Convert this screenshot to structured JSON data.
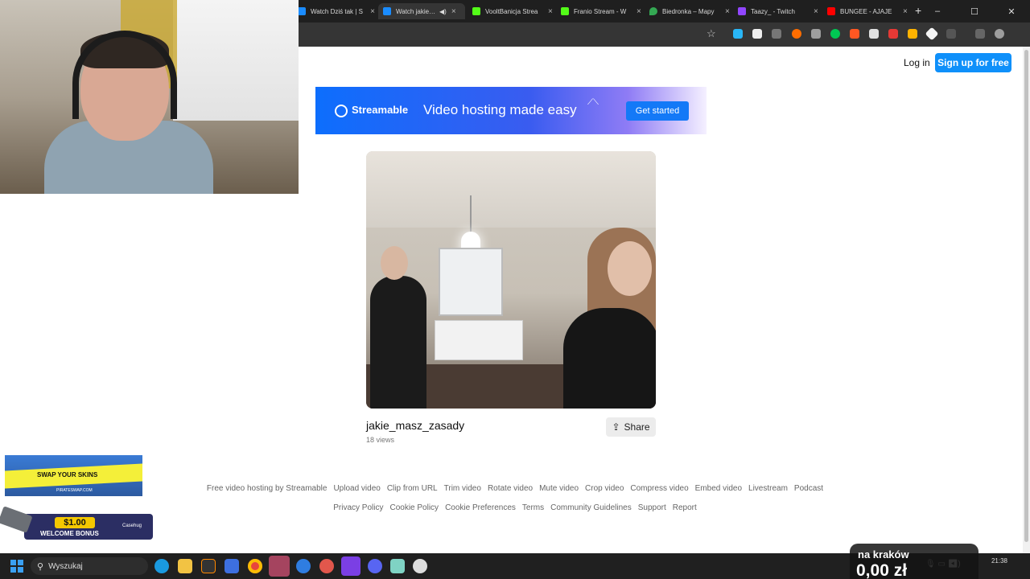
{
  "browser": {
    "tabs": [
      {
        "title": "Watch Dziś tak | S",
        "color": "#1a8cff"
      },
      {
        "title": "Watch jakie_m",
        "color": "#1a8cff",
        "active": true
      },
      {
        "title": "VooltBanicja Strea",
        "color": "#53fc18"
      },
      {
        "title": "Franio Stream - W",
        "color": "#53fc18"
      },
      {
        "title": "Biedronka – Mapy",
        "color": "#34a853"
      },
      {
        "title": "Taazy_ - Twitch",
        "color": "#9146ff"
      },
      {
        "title": "BUNGEE - AJAJE",
        "color": "#ff0000"
      }
    ],
    "new_tab": "+",
    "window_controls": {
      "minimize": "–",
      "maximize": "☐",
      "close": "✕"
    },
    "bookmark_icon": "star-icon"
  },
  "header": {
    "login": "Log in",
    "signup": "Sign up for free"
  },
  "banner": {
    "brand": "Streamable",
    "tagline": "Video hosting made easy",
    "cta": "Get started"
  },
  "video": {
    "title": "jakie_masz_zasady",
    "views": "18 views",
    "share": "Share"
  },
  "footer": {
    "row1": [
      "Free video hosting by Streamable",
      "Upload video",
      "Clip from URL",
      "Trim video",
      "Rotate video",
      "Mute video",
      "Crop video",
      "Compress video",
      "Embed video",
      "Livestream",
      "Podcast"
    ],
    "row2": [
      "Privacy Policy",
      "Cookie Policy",
      "Cookie Preferences",
      "Terms",
      "Community Guidelines",
      "Support",
      "Report"
    ]
  },
  "ads": {
    "ad1_text": "SWAP YOUR SKINS",
    "ad1_site": "PIRATESWAP.COM",
    "ad2_amount": "$1.00",
    "ad2_text": "WELCOME BONUS",
    "ad2_brand": "Casehug"
  },
  "taskbar": {
    "search_placeholder": "Wyszukaj",
    "time": "21:38"
  },
  "donation": {
    "label": "na kraków",
    "amount": "0,00 zł"
  }
}
